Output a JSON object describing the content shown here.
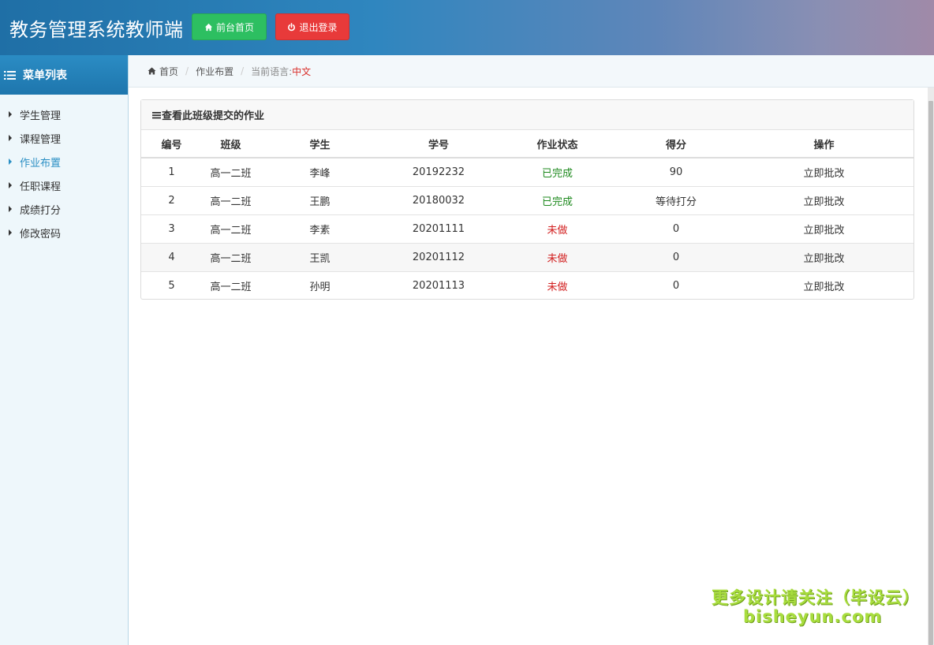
{
  "header": {
    "title": "教务管理系统教师端",
    "home_button": "前台首页",
    "logout_button": "退出登录"
  },
  "sidebar": {
    "title": "菜单列表",
    "items": [
      {
        "label": "学生管理"
      },
      {
        "label": "课程管理"
      },
      {
        "label": "作业布置",
        "active": true
      },
      {
        "label": "任职课程"
      },
      {
        "label": "成绩打分"
      },
      {
        "label": "修改密码"
      }
    ]
  },
  "breadcrumb": {
    "home": "首页",
    "current": "作业布置",
    "language_label": "当前语言:",
    "language_value": "中文"
  },
  "panel": {
    "title": "查看此班级提交的作业",
    "columns": [
      "编号",
      "班级",
      "学生",
      "学号",
      "作业状态",
      "得分",
      "操作"
    ],
    "rows": [
      {
        "id": "1",
        "class": "高一二班",
        "student": "李峰",
        "student_no": "20192232",
        "status": "已完成",
        "score": "90",
        "action": "立即批改"
      },
      {
        "id": "2",
        "class": "高一二班",
        "student": "王鹏",
        "student_no": "20180032",
        "status": "已完成",
        "score": "等待打分",
        "action": "立即批改"
      },
      {
        "id": "3",
        "class": "高一二班",
        "student": "李素",
        "student_no": "20201111",
        "status": "未做",
        "score": "0",
        "action": "立即批改"
      },
      {
        "id": "4",
        "class": "高一二班",
        "student": "王凯",
        "student_no": "20201112",
        "status": "未做",
        "score": "0",
        "action": "立即批改"
      },
      {
        "id": "5",
        "class": "高一二班",
        "student": "孙明",
        "student_no": "20201113",
        "status": "未做",
        "score": "0",
        "action": "立即批改"
      }
    ]
  },
  "watermark": {
    "line1": "更多设计请关注（毕设云）",
    "line2": "bisheyun.com"
  },
  "colors": {
    "header_gradient_start": "#1f6fa6",
    "header_gradient_end": "#a08aa8",
    "home_button": "#2dbf61",
    "logout_button": "#e83a3a",
    "active_menu": "#2a8fc4",
    "status_done": "#1f8a1f",
    "status_todo": "#d21f1f"
  }
}
